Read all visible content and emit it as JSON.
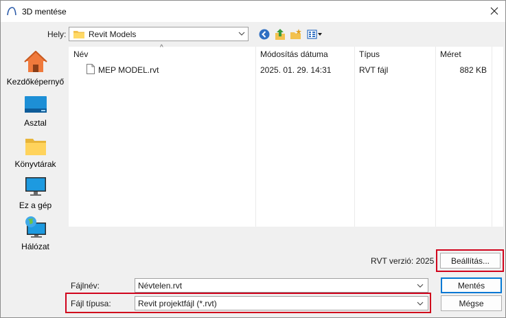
{
  "window": {
    "title": "3D mentése",
    "app_icon": "revit-arc-icon",
    "close_icon": "close-icon"
  },
  "location": {
    "label": "Hely:",
    "value": "Revit Models",
    "toolbar_icons": [
      "back-icon",
      "up-folder-icon",
      "new-folder-icon",
      "view-menu-icon"
    ]
  },
  "places": [
    {
      "label": "Kezdőképernyő",
      "icon": "home-icon"
    },
    {
      "label": "Asztal",
      "icon": "desktop-icon"
    },
    {
      "label": "Könyvtárak",
      "icon": "libraries-icon"
    },
    {
      "label": "Ez a gép",
      "icon": "this-pc-icon"
    },
    {
      "label": "Hálózat",
      "icon": "network-icon"
    }
  ],
  "filelist": {
    "columns": [
      "Név",
      "Módosítás dátuma",
      "Típus",
      "Méret"
    ],
    "rows": [
      {
        "name": "MEP MODEL.rvt",
        "modified": "2025. 01. 29. 14:31",
        "type": "RVT fájl",
        "size": "882 KB"
      }
    ]
  },
  "rvt_version": "RVT verzió: 2025",
  "buttons": {
    "options": "Beállítás...",
    "save": "Mentés",
    "cancel": "Mégse"
  },
  "filename": {
    "label": "Fájlnév:",
    "value": "Névtelen.rvt"
  },
  "filetype": {
    "label": "Fájl típusa:",
    "value": "Revit projektfájl (*.rvt)"
  },
  "colors": {
    "highlight": "#d0021b",
    "accent": "#0078d4"
  }
}
